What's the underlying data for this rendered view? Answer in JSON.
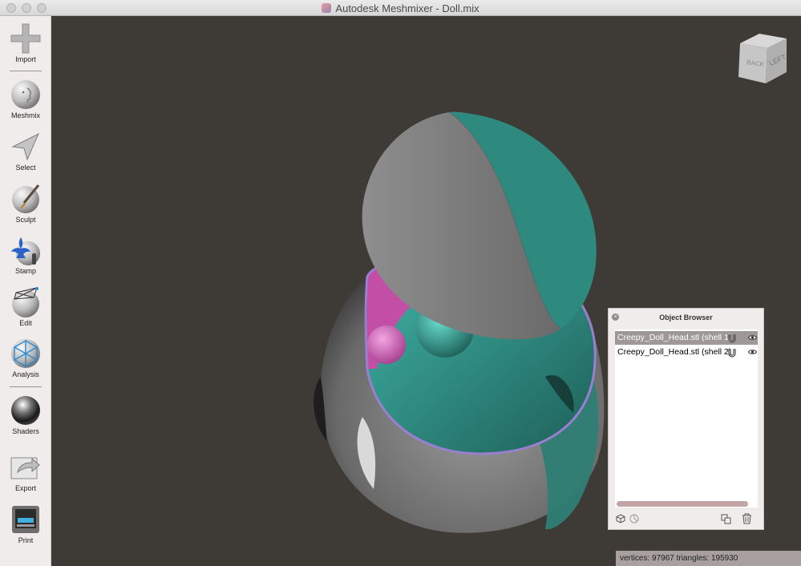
{
  "window": {
    "title": "Autodesk Meshmixer - Doll.mix",
    "app_icon": "meshmixer-app-icon"
  },
  "toolbar": {
    "tools": [
      {
        "id": "import",
        "label": "Import",
        "icon": "plus-icon"
      },
      {
        "id": "meshmix",
        "label": "Meshmix",
        "icon": "head-sphere-icon"
      },
      {
        "id": "select",
        "label": "Select",
        "icon": "arrow-cursor-icon"
      },
      {
        "id": "sculpt",
        "label": "Sculpt",
        "icon": "brush-sphere-icon"
      },
      {
        "id": "stamp",
        "label": "Stamp",
        "icon": "fleur-de-lis-icon"
      },
      {
        "id": "edit",
        "label": "Edit",
        "icon": "wireframe-sphere-icon"
      },
      {
        "id": "analysis",
        "label": "Analysis",
        "icon": "mesh-sphere-icon"
      },
      {
        "id": "shaders",
        "label": "Shaders",
        "icon": "chrome-sphere-icon"
      },
      {
        "id": "export",
        "label": "Export",
        "icon": "export-arrow-icon"
      },
      {
        "id": "print",
        "label": "Print",
        "icon": "printer-icon"
      }
    ]
  },
  "navcube": {
    "faces": [
      "BACK",
      "LEFT"
    ]
  },
  "object_browser": {
    "title": "Object Browser",
    "items": [
      {
        "name": "Creepy_Doll_Head.stl (shell 1)",
        "selected": true
      },
      {
        "name": "Creepy_Doll_Head.stl (shell 2)",
        "selected": false
      }
    ]
  },
  "status": {
    "text": "vertices: 97967 triangles: 195930"
  },
  "colors": {
    "viewport_bg": "#3e3a36",
    "sidebar_bg": "#f0ecec",
    "mesh_gray": "#8a8a8a",
    "mesh_teal": "#2f8a80",
    "mesh_pink": "#d96ac0",
    "seam_purple": "#9a7fd0",
    "selected_row": "#9e9898"
  }
}
